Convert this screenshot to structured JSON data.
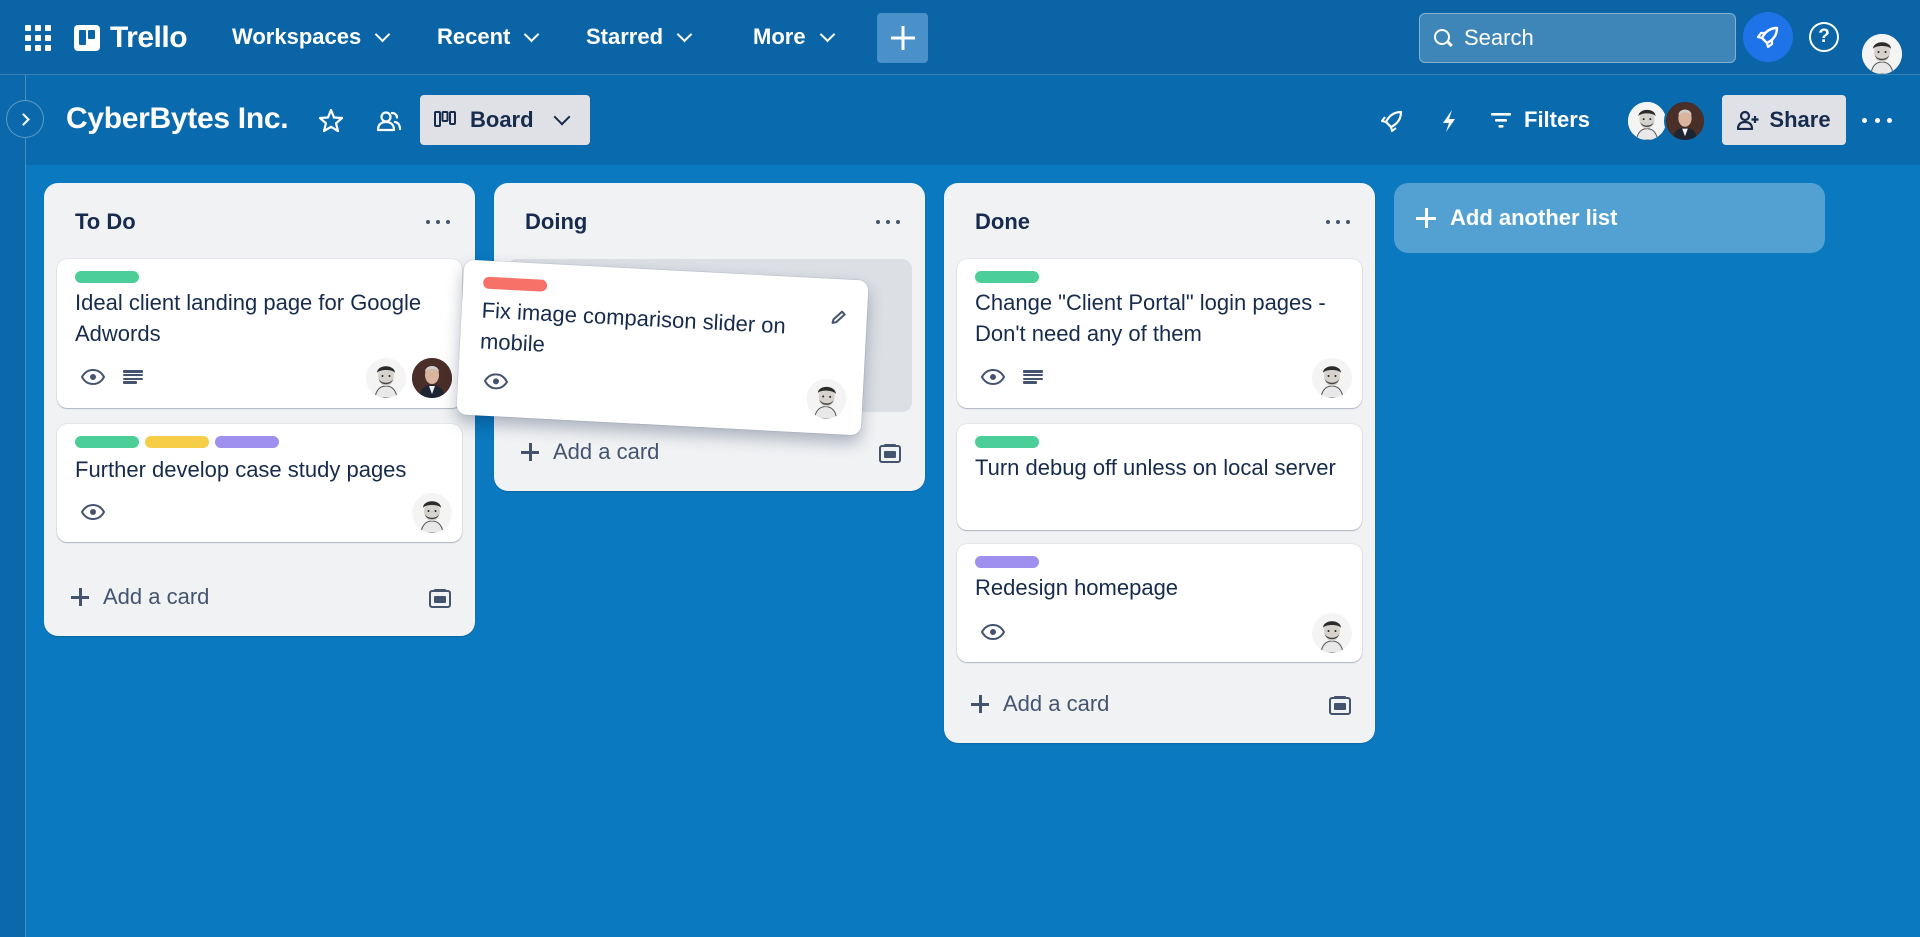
{
  "app": {
    "name": "Trello",
    "nav": [
      {
        "label": "Workspaces"
      },
      {
        "label": "Recent"
      },
      {
        "label": "Starred"
      },
      {
        "label": "More"
      }
    ],
    "search_placeholder": "Search"
  },
  "board": {
    "title": "CyberBytes Inc.",
    "view_label": "Board",
    "filters_label": "Filters",
    "share_label": "Share"
  },
  "colors": {
    "green": "#4bce97",
    "yellow": "#f5cd47",
    "purple": "#9f8fef",
    "red": "#f87168",
    "board_bg": "#0a79bf"
  },
  "lists": [
    {
      "title": "To Do",
      "add_card_label": "Add a card",
      "cards": [
        {
          "title": "Ideal client landing page for Google Adwords",
          "labels": [
            "green"
          ],
          "watching": true,
          "has_description": true,
          "members": [
            "man-light",
            "man-dark"
          ]
        },
        {
          "title": "Further develop case study pages",
          "labels": [
            "green",
            "yellow",
            "purple"
          ],
          "watching": true,
          "has_description": false,
          "members": [
            "man-light"
          ]
        }
      ]
    },
    {
      "title": "Doing",
      "add_card_label": "Add a card",
      "cards": [],
      "dragging_card": {
        "title": "Fix image comparison slider on mobile",
        "labels": [
          "red"
        ],
        "watching": true,
        "members": [
          "man-light"
        ]
      }
    },
    {
      "title": "Done",
      "add_card_label": "Add a card",
      "cards": [
        {
          "title": "Change \"Client Portal\" login pages - Don't need any of them",
          "labels": [
            "green"
          ],
          "watching": true,
          "has_description": true,
          "members": [
            "man-light"
          ]
        },
        {
          "title": "Turn debug off unless on local server",
          "labels": [
            "green"
          ],
          "watching": false,
          "has_description": false,
          "members": []
        },
        {
          "title": "Redesign homepage",
          "labels": [
            "purple"
          ],
          "watching": true,
          "has_description": false,
          "members": [
            "man-light"
          ]
        }
      ]
    }
  ],
  "add_list_label": "Add another list"
}
